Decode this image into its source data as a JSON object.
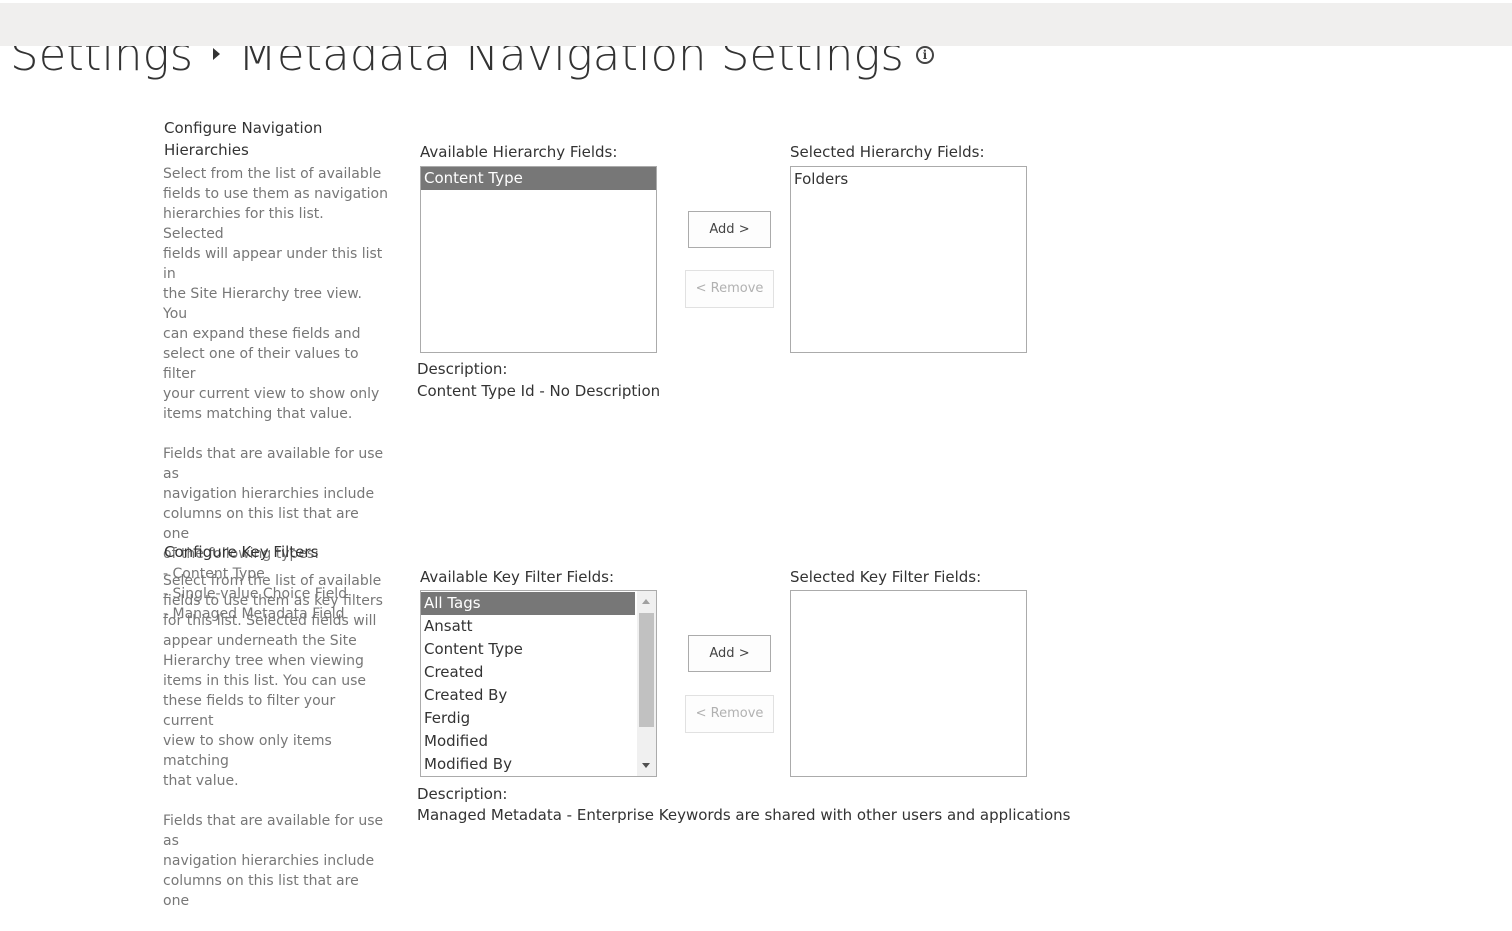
{
  "header": {
    "breadcrumb_parent": "Settings",
    "page_title": "Metadata Navigation Settings",
    "info_glyph": "i"
  },
  "hierarchies": {
    "title": "Configure Navigation Hierarchies",
    "description_lines": [
      "Select from the list of available",
      "fields to use them as navigation",
      "hierarchies for this list.  Selected",
      "fields will appear under this list in",
      "the Site Hierarchy tree view.  You",
      "can expand these fields and",
      "select one of their values to filter",
      "your current view to show only",
      "items matching that value."
    ],
    "types_lines": [
      "Fields that are available for use as",
      "navigation hierarchies include",
      "columns on this list that are one",
      "of the following types:",
      "- Content Type",
      "- Single-value Choice Field",
      "- Managed Metadata Field"
    ],
    "available_label": "Available Hierarchy Fields:",
    "available_items": [
      "Content Type"
    ],
    "available_selected_index": 0,
    "selected_label": "Selected Hierarchy Fields:",
    "selected_items": [
      "Folders"
    ],
    "add_label": "Add >",
    "remove_label": "< Remove",
    "description_label": "Description:",
    "description_value": "Content Type Id - No Description"
  },
  "key_filters": {
    "title": "Configure Key Filters",
    "description_lines": [
      "Select from the list of available",
      "fields to use them as key filters",
      "for this list.  Selected fields will",
      "appear underneath the Site",
      "Hierarchy tree when viewing",
      "items in this list.  You can use",
      "these fields to filter your current",
      "view to show only items matching",
      "that value."
    ],
    "types_lines": [
      "Fields that are available for use as",
      "navigation hierarchies include",
      "columns on this list that are one"
    ],
    "available_label": "Available Key Filter Fields:",
    "available_items": [
      "All Tags",
      "Ansatt",
      "Content Type",
      "Created",
      "Created By",
      "Ferdig",
      "Modified",
      "Modified By"
    ],
    "available_selected_index": 0,
    "selected_label": "Selected Key Filter Fields:",
    "selected_items": [],
    "add_label": "Add >",
    "remove_label": "< Remove",
    "description_label": "Description:",
    "description_value": "Managed Metadata - Enterprise Keywords are shared with other users and applications"
  },
  "colors": {
    "selected_option_bg": "#777777",
    "topbar_bg": "#f0efee",
    "description_text": "#777777",
    "disabled_button_text": "#b1b1b1"
  }
}
